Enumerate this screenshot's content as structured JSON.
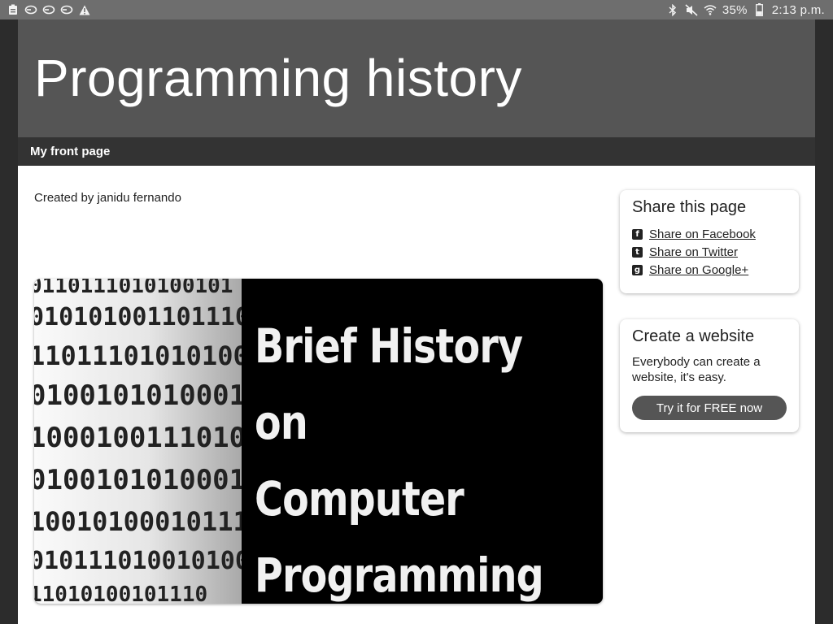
{
  "statusbar": {
    "left_icons": [
      "clipboard-icon",
      "sync-icon",
      "sync-icon",
      "sync-icon",
      "warning-icon"
    ],
    "battery_percent": "35%",
    "time": "2:13 p.m."
  },
  "header": {
    "site_title": "Programming history"
  },
  "navbar": {
    "items": [
      {
        "label": "My front page"
      }
    ]
  },
  "content": {
    "creator": "Created by janidu fernando",
    "hero": {
      "lines": [
        "Brief History on",
        "Computer",
        "Programming"
      ]
    }
  },
  "sidebar": {
    "share": {
      "title": "Share this page",
      "links": [
        {
          "label": "Share on Facebook",
          "icon": "f"
        },
        {
          "label": "Share on Twitter",
          "icon": "t"
        },
        {
          "label": "Share on Google+",
          "icon": "g"
        }
      ]
    },
    "website": {
      "title": "Create a website",
      "text": "Everybody can create a website, it's easy.",
      "button": "Try it for FREE now"
    }
  },
  "colors": {
    "header_bg": "#555555",
    "nav_bg": "#333333",
    "button_bg": "#555555"
  }
}
